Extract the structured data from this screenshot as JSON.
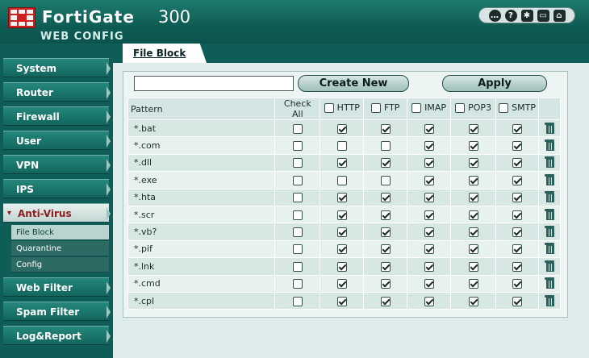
{
  "header": {
    "brand": "FortiGate",
    "model": "300",
    "subtitle": "WEB CONFIG",
    "tool_icons": [
      "chat-icon",
      "help-icon",
      "console-icon",
      "window-icon",
      "logout-icon"
    ]
  },
  "sidebar": {
    "items": [
      {
        "label": "System"
      },
      {
        "label": "Router"
      },
      {
        "label": "Firewall"
      },
      {
        "label": "User"
      },
      {
        "label": "VPN"
      },
      {
        "label": "IPS"
      },
      {
        "label": "Anti-Virus"
      },
      {
        "label": "Web Filter"
      },
      {
        "label": "Spam Filter"
      },
      {
        "label": "Log&Report"
      }
    ],
    "subitems": [
      {
        "label": "File Block"
      },
      {
        "label": "Quarantine"
      },
      {
        "label": "Config"
      }
    ]
  },
  "tab": {
    "label": "File Block"
  },
  "toolbar": {
    "search_value": "",
    "create_label": "Create New",
    "apply_label": "Apply"
  },
  "table": {
    "headers": {
      "pattern": "Pattern",
      "check_all_1": "Check",
      "check_all_2": "All",
      "http": "HTTP",
      "ftp": "FTP",
      "imap": "IMAP",
      "pop3": "POP3",
      "smtp": "SMTP"
    },
    "rows": [
      {
        "pattern": "*.bat",
        "checks": [
          false,
          true,
          true,
          true,
          true,
          true
        ]
      },
      {
        "pattern": "*.com",
        "checks": [
          false,
          false,
          false,
          true,
          true,
          true
        ]
      },
      {
        "pattern": "*.dll",
        "checks": [
          false,
          true,
          true,
          true,
          true,
          true
        ]
      },
      {
        "pattern": "*.exe",
        "checks": [
          false,
          false,
          false,
          true,
          true,
          true
        ]
      },
      {
        "pattern": "*.hta",
        "checks": [
          false,
          true,
          true,
          true,
          true,
          true
        ]
      },
      {
        "pattern": "*.scr",
        "checks": [
          false,
          true,
          true,
          true,
          true,
          true
        ]
      },
      {
        "pattern": "*.vb?",
        "checks": [
          false,
          true,
          true,
          true,
          true,
          true
        ]
      },
      {
        "pattern": "*.pif",
        "checks": [
          false,
          true,
          true,
          true,
          true,
          true
        ]
      },
      {
        "pattern": "*.lnk",
        "checks": [
          false,
          true,
          true,
          true,
          true,
          true
        ]
      },
      {
        "pattern": "*.cmd",
        "checks": [
          false,
          true,
          true,
          true,
          true,
          true
        ]
      },
      {
        "pattern": "*.cpl",
        "checks": [
          false,
          true,
          true,
          true,
          true,
          true
        ]
      }
    ]
  }
}
